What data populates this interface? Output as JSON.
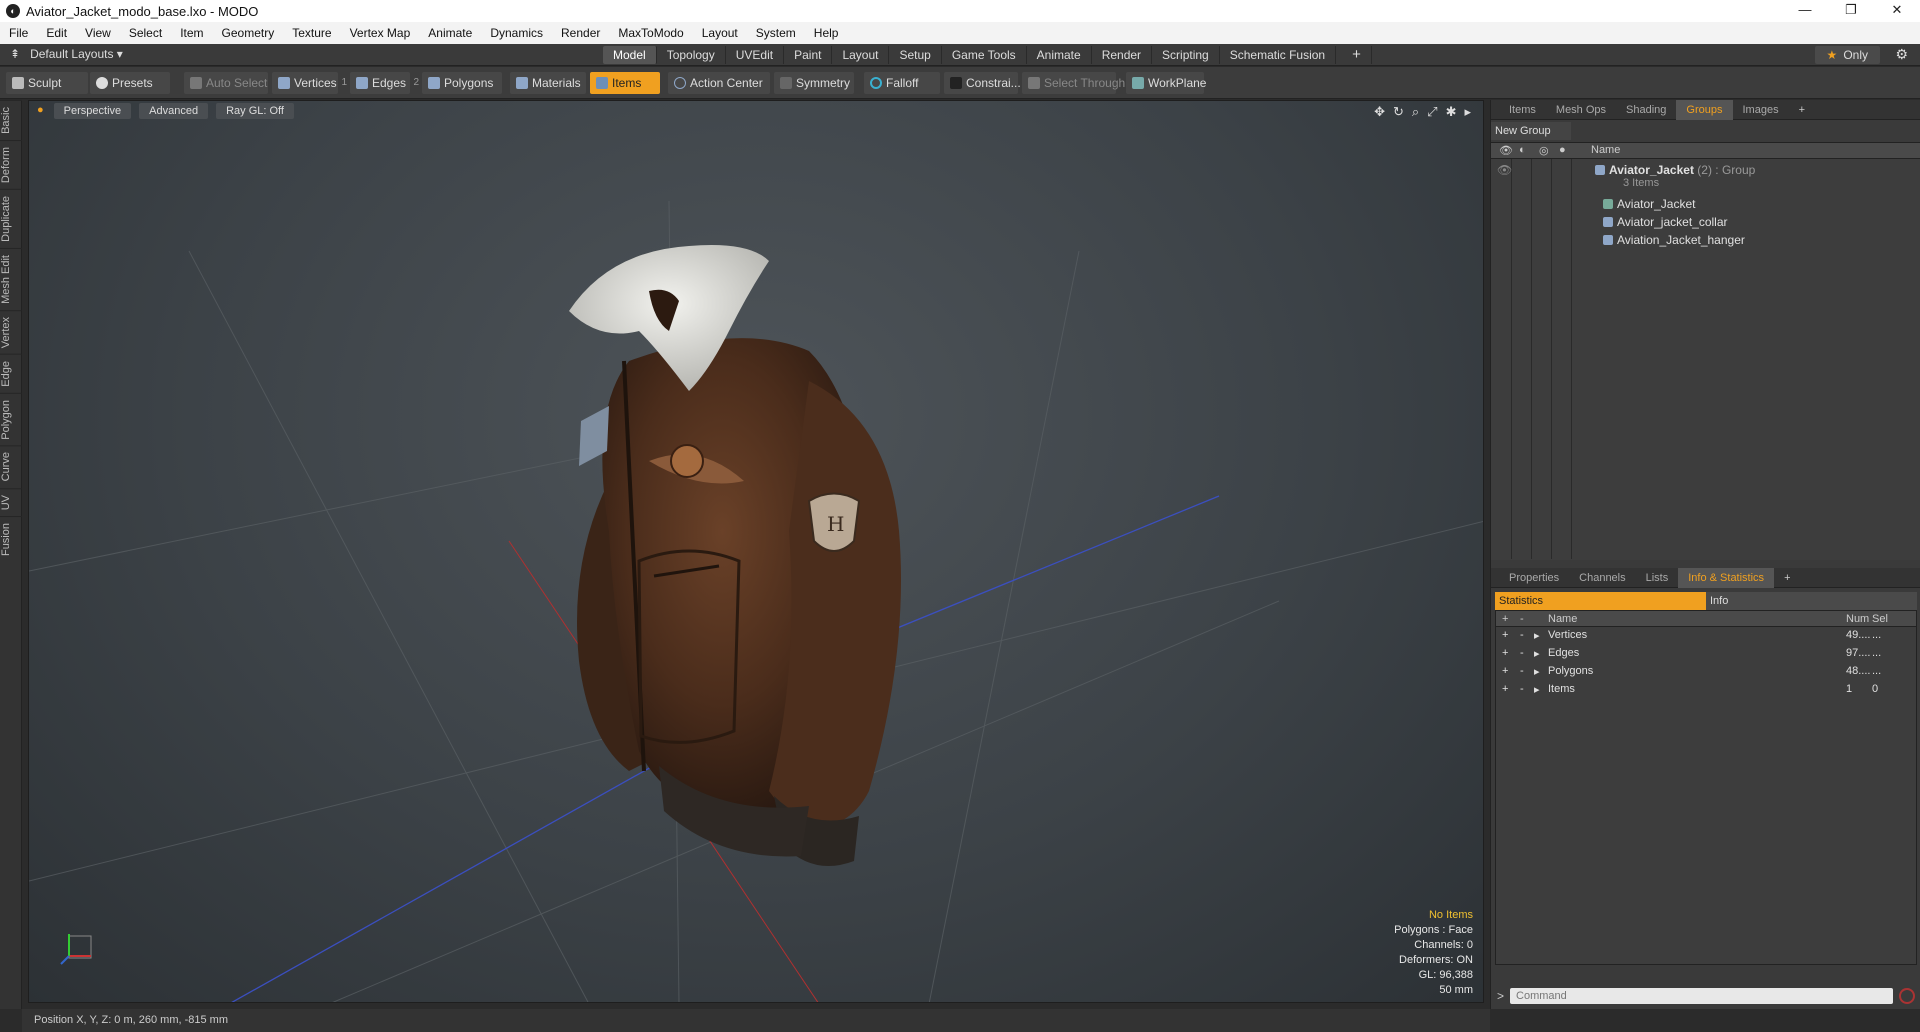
{
  "window": {
    "title": "Aviator_Jacket_modo_base.lxo - MODO",
    "controls": [
      "—",
      "❐",
      "✕"
    ]
  },
  "menu": [
    "File",
    "Edit",
    "View",
    "Select",
    "Item",
    "Geometry",
    "Texture",
    "Vertex Map",
    "Animate",
    "Dynamics",
    "Render",
    "MaxToModo",
    "Layout",
    "System",
    "Help"
  ],
  "layoutbar": {
    "layouts_label": "Default Layouts ▾",
    "tabs": [
      "Model",
      "Topology",
      "UVEdit",
      "Paint",
      "Layout",
      "Setup",
      "Game Tools",
      "Animate",
      "Render",
      "Scripting",
      "Schematic Fusion"
    ],
    "active_tab": "Model",
    "plus": "+",
    "only_label": "Only",
    "gear": "⚙"
  },
  "toolbar": {
    "sculpt": "Sculpt",
    "presets": "Presets",
    "auto_select": "Auto Select",
    "vertices": "Vertices",
    "vertices_num": "1",
    "edges": "Edges",
    "edges_num": "2",
    "polygons": "Polygons",
    "materials": "Materials",
    "items": "Items",
    "action_center": "Action Center",
    "symmetry": "Symmetry",
    "falloff": "Falloff",
    "constraints": "Constrai...",
    "select_through": "Select Through",
    "workplane": "WorkPlane"
  },
  "sidebar_tabs": [
    "Basic",
    "Deform",
    "Duplicate",
    "Mesh Edit",
    "Vertex",
    "Edge",
    "Polygon",
    "Curve",
    "UV",
    "Fusion"
  ],
  "viewport": {
    "view_mode": "Perspective",
    "advanced": "Advanced",
    "raygl": "Ray GL: Off",
    "info": {
      "no_items": "No Items",
      "polygons": "Polygons : Face",
      "channels": "Channels: 0",
      "deformers": "Deformers: ON",
      "gl": "GL: 96,388",
      "scale": "50 mm"
    },
    "colors": {
      "warn": "#f0c030",
      "accent": "#f0a020"
    }
  },
  "groups_panel": {
    "tabs": [
      "Items",
      "Mesh Ops",
      "Shading",
      "Groups",
      "Images",
      "+"
    ],
    "active_tab": "Groups",
    "new_group": "New Group",
    "column_name": "Name",
    "group": {
      "name": "Aviator_Jacket",
      "count": "(2)",
      "type": ": Group",
      "items_label": "3 Items"
    },
    "children": [
      "Aviator_Jacket",
      "Aviator_jacket_collar",
      "Aviation_Jacket_hanger"
    ]
  },
  "stats_panel": {
    "tabs": [
      "Properties",
      "Channels",
      "Lists",
      "Info & Statistics",
      "+"
    ],
    "active_tab": "Info & Statistics",
    "subtabs": {
      "statistics": "Statistics",
      "info": "Info"
    },
    "columns": {
      "name": "Name",
      "num": "Num",
      "sel": "Sel"
    },
    "rows": [
      {
        "name": "Vertices",
        "num": "49....",
        "sel": "..."
      },
      {
        "name": "Edges",
        "num": "97....",
        "sel": "..."
      },
      {
        "name": "Polygons",
        "num": "48....",
        "sel": "..."
      },
      {
        "name": "Items",
        "num": "1",
        "sel": "0"
      }
    ],
    "command_placeholder": "Command",
    "prompt": ">"
  },
  "statusbar": {
    "text": "Position X, Y, Z:   0 m, 260 mm, -815 mm"
  }
}
